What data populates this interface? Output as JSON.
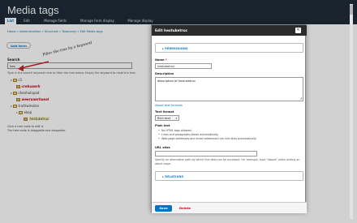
{
  "page": {
    "title": "Media tags"
  },
  "tabs": [
    {
      "label": "List",
      "active": true
    },
    {
      "label": "Edit",
      "active": false
    },
    {
      "label": "Manage fields",
      "active": false
    },
    {
      "label": "Manage form display",
      "active": false
    },
    {
      "label": "Manage display",
      "active": false
    }
  ],
  "breadcrumb": "Home » Administration » Structure » Taxonomy » Edit Media tags",
  "add_term_label": "Add term",
  "search": {
    "label": "Search",
    "value": "hes",
    "description": "Type in the search keyword here to filter the tree below. Empty the keyword to reset the tree."
  },
  "annotation": "Filter the tree by a keyword",
  "tree": {
    "items": [
      {
        "label": "c1",
        "style": "normal"
      },
      {
        "label": "crehuaerh",
        "style": "red"
      },
      {
        "label": "chenhulopad",
        "style": "normal"
      },
      {
        "label": "weeruaerhueal",
        "style": "red"
      },
      {
        "label": "truthwmoilar",
        "style": "normal"
      },
      {
        "label": "ekop",
        "style": "normal"
      },
      {
        "label": "hestuketruc",
        "style": "highlight"
      }
    ],
    "note1": "Click a tree node to edit it.",
    "note2": "The tree node is draggable and droppable"
  },
  "dialog": {
    "title": "Edit hestuketruc",
    "close_glyph": "✕",
    "permissions_label": "▸ PERMISSIONS",
    "name_label": "Name",
    "name_required": "*",
    "name_value": "hestuketruc",
    "description_label": "Description",
    "description_value": "description of hestuketruc",
    "about_formats": "About text formats",
    "text_format_label": "Text format",
    "text_format_value": "Rich text",
    "plain_text_label": "Plain text",
    "plain_text_bullets": [
      "No HTML tags allowed.",
      "Lines and paragraphs break automatically.",
      "Web page addresses and email addresses turn into links automatically."
    ],
    "url_alias_label": "URL alias",
    "url_alias_value": "",
    "url_alias_desc": "Specify an alternative path by which this data can be accessed. For example, type \"/about\" when writing an about page.",
    "relations_label": "▸ RELATIONS",
    "save_label": "Save",
    "delete_label": "Delete"
  },
  "colors": {
    "header_bg": "#1e2b38",
    "link": "#0074bd",
    "danger": "#d0021b",
    "highlight": "#fffbcc"
  }
}
